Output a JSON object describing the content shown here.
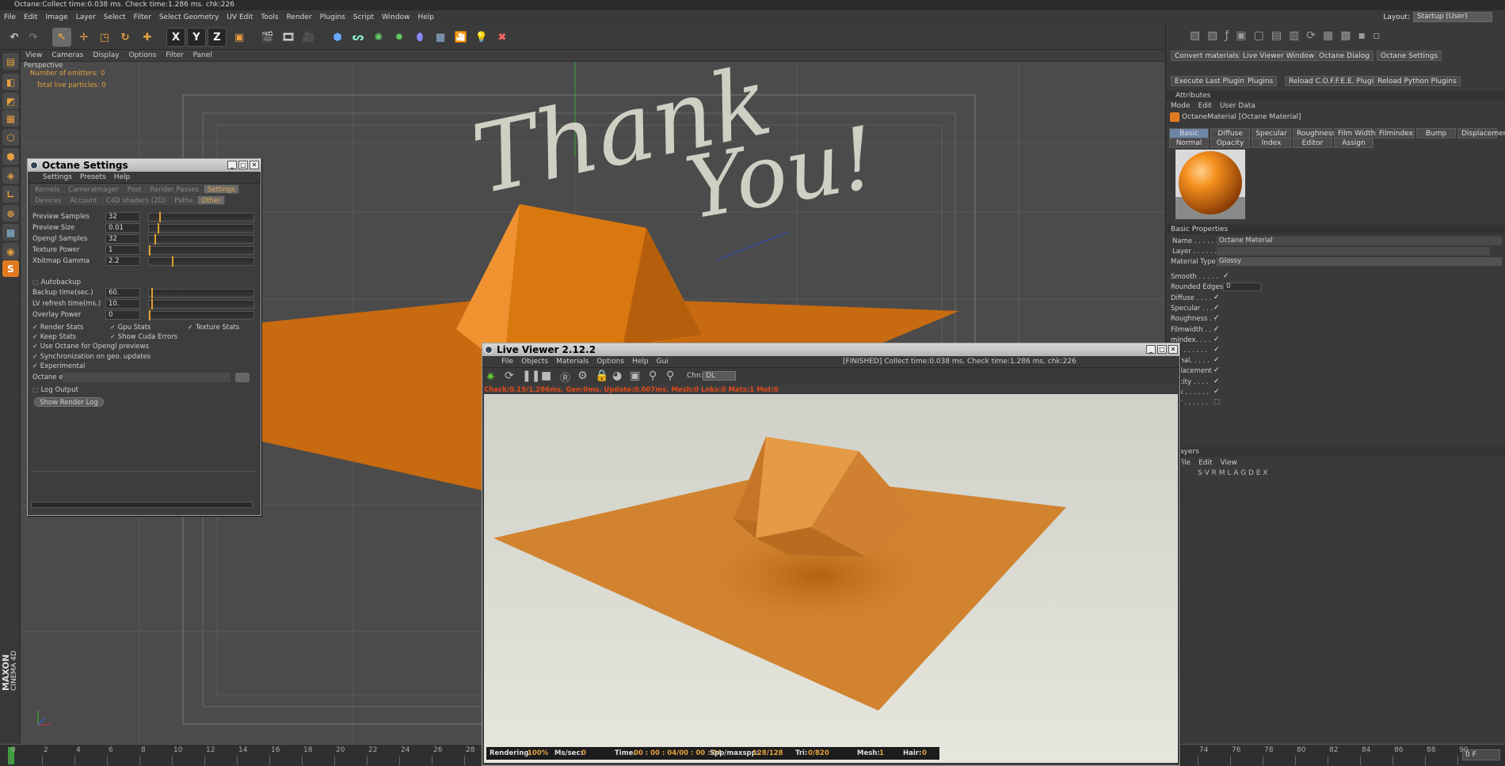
{
  "status_bar": "Octane:Collect time:0.038 ms.  Check time:1.286 ms.  chk:226",
  "menu": [
    "File",
    "Edit",
    "Image",
    "Layer",
    "Select",
    "Filter",
    "Select Geometry",
    "UV Edit",
    "Tools",
    "Render",
    "Plugins",
    "Script",
    "Window",
    "Help"
  ],
  "layout": {
    "label": "Layout:",
    "value": "Startup (User)"
  },
  "toolbar": {
    "axis_x": "X",
    "axis_y": "Y",
    "axis_z": "Z"
  },
  "viewport": {
    "menu": [
      "View",
      "Cameras",
      "Display",
      "Options",
      "Filter",
      "Panel"
    ],
    "label": "Perspective",
    "emitters": "Number of emitters: 0",
    "particles": "Total live particles: 0",
    "handwriting": [
      "Thank",
      "You!"
    ],
    "logo_top": "MAXON",
    "logo_bottom": "CINEMA 4D"
  },
  "timeline": {
    "ticks": [
      "0",
      "2",
      "4",
      "6",
      "8",
      "10",
      "12",
      "14",
      "16",
      "18",
      "20",
      "22",
      "24",
      "26",
      "28",
      "30",
      "74",
      "76",
      "78",
      "80",
      "82",
      "84",
      "86",
      "88",
      "90"
    ],
    "frame": "0 F"
  },
  "right_panel": {
    "chips_row1": [
      "Convert materials",
      "Live Viewer Window",
      "Octane Dialog",
      "Octane Settings"
    ],
    "chips_row2": [
      "Execute Last Plugin",
      "Plugins",
      "Reload C.O.F.F.E.E. Plugins",
      "Reload Python Plugins"
    ],
    "attributes_title": "Attributes",
    "attr_menu": [
      "Mode",
      "Edit",
      "User Data"
    ],
    "material_title": "OctaneMaterial [Octane Material]",
    "mat_tabs_row1": [
      "Basic",
      "Diffuse",
      "Specular",
      "Roughness",
      "Film Width",
      "Filmindex",
      "Bump",
      "Displacement"
    ],
    "mat_tabs_row2": [
      "Normal",
      "Opacity",
      "Index",
      "Editor",
      "Assign"
    ],
    "basic_properties": "Basic Properties",
    "name_label": "Name . . . . . . .",
    "name_value": "Octane Material",
    "layer_label": "Layer . . . . . . .",
    "material_type_label": "Material Type",
    "material_type_value": "Glossy",
    "smooth": "Smooth . . . . .",
    "rounded_edges": "Rounded Edges",
    "rounded_edges_value": "0",
    "channels": [
      "Diffuse . . . .",
      "Specular . . .",
      "Roughness . .",
      "Filmwidth . . .",
      "mindex. . . .",
      "mp . . . . . .",
      "ormal. . . . .",
      "isplacement",
      "pacity . . . .",
      "dex . . . . . .",
      "itor . . . . . ."
    ],
    "layers_title": "Layers",
    "layers_menu": [
      "File",
      "Edit",
      "View"
    ],
    "layers_cols": "S V R M L A G D E X"
  },
  "octane_settings": {
    "title": "Octane Settings",
    "menu": [
      "Settings",
      "Presets",
      "Help"
    ],
    "tabs1": [
      "Kernels",
      "CameraImager",
      "Post",
      "Render Passes",
      "Settings"
    ],
    "tabs2": [
      "Devices",
      "Account",
      "C4D shaders (2D)",
      "Paths",
      "Other"
    ],
    "rows": [
      {
        "label": "Preview Samples",
        "value": "32",
        "knob": 0.1
      },
      {
        "label": "Preview Size",
        "value": "0.01",
        "knob": 0.08
      },
      {
        "label": "Opengl Samples",
        "value": "32",
        "knob": 0.05
      },
      {
        "label": "Texture Power",
        "value": "1",
        "knob": 0.0
      },
      {
        "label": "Xbitmap Gamma",
        "value": "2.2",
        "knob": 0.22
      }
    ],
    "autobackup": "Autobackup",
    "rows2": [
      {
        "label": "Backup time(sec.)",
        "value": "60.",
        "knob": 0.02
      },
      {
        "label": "LV refresh time(ms.)",
        "value": "10.",
        "knob": 0.02
      },
      {
        "label": "Overlay Power",
        "value": "0",
        "knob": 0.0
      }
    ],
    "render_stats": "Render Stats",
    "gpu_stats": "Gpu Stats",
    "texture_stats": "Texture Stats",
    "keep_stats": "Keep Stats",
    "show_cuda": "Show Cuda Errors",
    "use_octane": "Use Octane for Opengl previews",
    "sync": "Synchronization on geo. updates",
    "experimental": "Experimental",
    "octane_exe": "Octane ex",
    "log_output": "Log Output",
    "show_render_log": "Show Render Log"
  },
  "live_viewer": {
    "title": "Live Viewer 2.12.2",
    "menu": [
      "File",
      "Objects",
      "Materials",
      "Options",
      "Help",
      "Gui"
    ],
    "finished": "[FINISHED] Collect time:0.038 ms.  Check time:1.286 ms.  chk:226",
    "chn_label": "Chn:",
    "chn_value": "DL",
    "check_line": "Check:0.19/1.286ms. Gen:0ms. Update:0.007ms. Mesh:0 Lnks:0 Mats:1 Mot:0",
    "rendering_label": "Rendering:",
    "rendering_value": "100%",
    "mssec_label": "Ms/sec:",
    "mssec_value": "0",
    "time_label": "Time:",
    "time_value": "00 : 00 : 04/00 : 00 : 04",
    "spp_label": "Spp/maxspp:",
    "spp_value": "128/128",
    "tri_label": "Tri:",
    "tri_value": "0/820",
    "mesh_label": "Mesh:",
    "mesh_value": "1",
    "hair_label": "Hair:",
    "hair_value": "0"
  }
}
